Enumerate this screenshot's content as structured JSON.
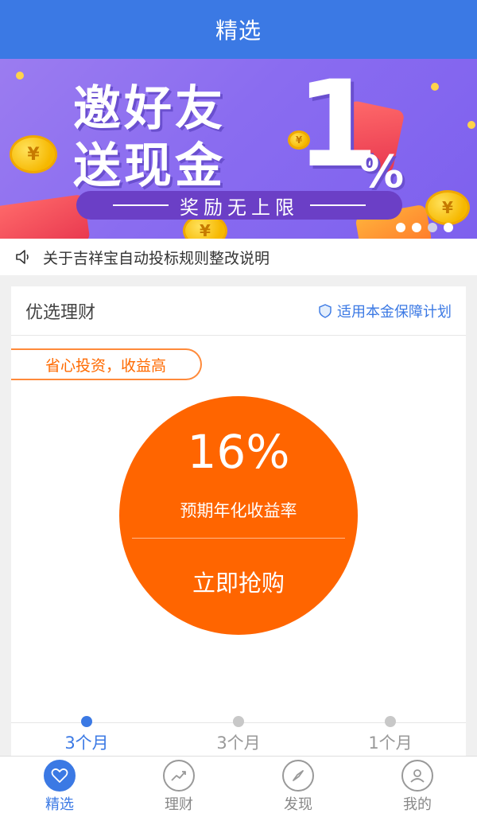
{
  "header": {
    "title": "精选"
  },
  "banner": {
    "line1": "邀好友",
    "line2": "送现金",
    "big_number": "1",
    "percent": "%",
    "reward_text": "奖励无上限",
    "coin_symbol": "¥",
    "slides_count": 4,
    "active_slide": 1
  },
  "notice": {
    "text": "关于吉祥宝自动投标规则整改说明"
  },
  "card": {
    "title": "优选理财",
    "guarantee_text": "适用本金保障计划",
    "slogan": "省心投资，收益高",
    "rate": "16%",
    "rate_label": "预期年化收益率",
    "buy_label": "立即抢购",
    "periods": [
      {
        "label": "3个月",
        "active": true
      },
      {
        "label": "3个月",
        "active": false
      },
      {
        "label": "1个月",
        "active": false
      }
    ]
  },
  "tabbar": {
    "items": [
      {
        "label": "精选",
        "icon": "heart-icon",
        "active": true
      },
      {
        "label": "理财",
        "icon": "chart-icon",
        "active": false
      },
      {
        "label": "发现",
        "icon": "compass-icon",
        "active": false
      },
      {
        "label": "我的",
        "icon": "user-icon",
        "active": false
      }
    ]
  },
  "colors": {
    "primary": "#3b79e4",
    "accent": "#ff6500",
    "banner_bg": "#8a6cf0"
  }
}
